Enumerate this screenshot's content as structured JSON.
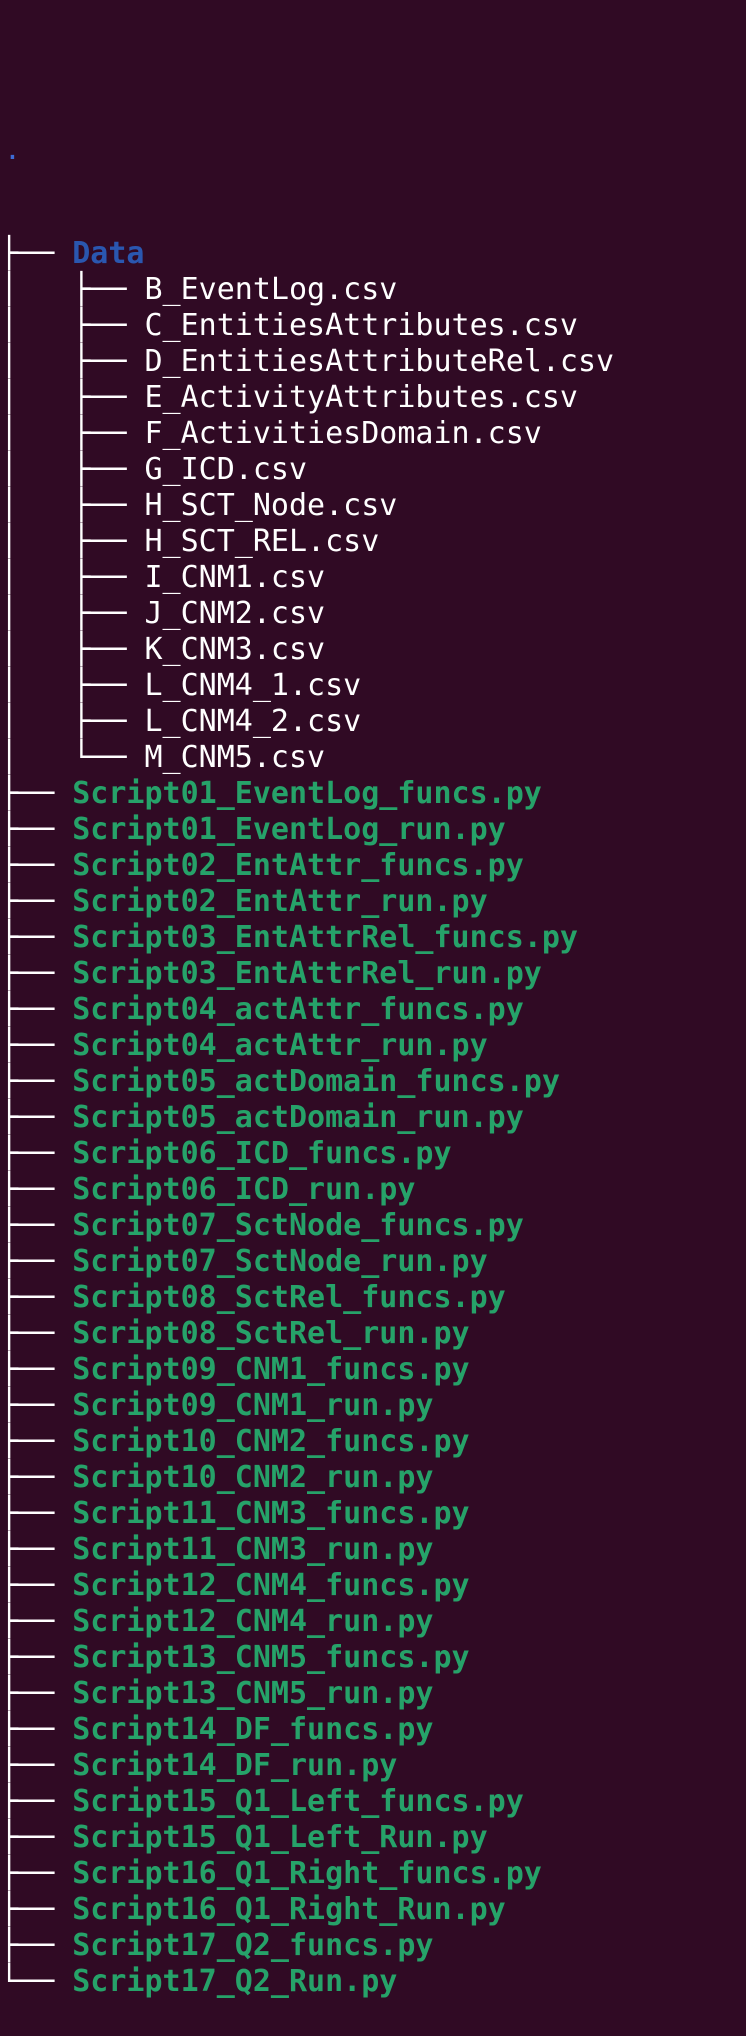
{
  "tree": {
    "root": ".",
    "dir_name": "Data",
    "data_files": [
      "B_EventLog.csv",
      "C_EntitiesAttributes.csv",
      "D_EntitiesAttributeRel.csv",
      "E_ActivityAttributes.csv",
      "F_ActivitiesDomain.csv",
      "G_ICD.csv",
      "H_SCT_Node.csv",
      "H_SCT_REL.csv",
      "I_CNM1.csv",
      "J_CNM2.csv",
      "K_CNM3.csv",
      "L_CNM4_1.csv",
      "L_CNM4_2.csv",
      "M_CNM5.csv"
    ],
    "scripts": [
      "Script01_EventLog_funcs.py",
      "Script01_EventLog_run.py",
      "Script02_EntAttr_funcs.py",
      "Script02_EntAttr_run.py",
      "Script03_EntAttrRel_funcs.py",
      "Script03_EntAttrRel_run.py",
      "Script04_actAttr_funcs.py",
      "Script04_actAttr_run.py",
      "Script05_actDomain_funcs.py",
      "Script05_actDomain_run.py",
      "Script06_ICD_funcs.py",
      "Script06_ICD_run.py",
      "Script07_SctNode_funcs.py",
      "Script07_SctNode_run.py",
      "Script08_SctRel_funcs.py",
      "Script08_SctRel_run.py",
      "Script09_CNM1_funcs.py",
      "Script09_CNM1_run.py",
      "Script10_CNM2_funcs.py",
      "Script10_CNM2_run.py",
      "Script11_CNM3_funcs.py",
      "Script11_CNM3_run.py",
      "Script12_CNM4_funcs.py",
      "Script12_CNM4_run.py",
      "Script13_CNM5_funcs.py",
      "Script13_CNM5_run.py",
      "Script14_DF_funcs.py",
      "Script14_DF_run.py",
      "Script15_Q1_Left_funcs.py",
      "Script15_Q1_Left_Run.py",
      "Script16_Q1_Right_funcs.py",
      "Script16_Q1_Right_Run.py",
      "Script17_Q2_funcs.py",
      "Script17_Q2_Run.py"
    ]
  },
  "colors": {
    "background": "#300a24",
    "directory": "#2a57b0",
    "executable": "#26a269",
    "plain_file": "#ffffff"
  }
}
